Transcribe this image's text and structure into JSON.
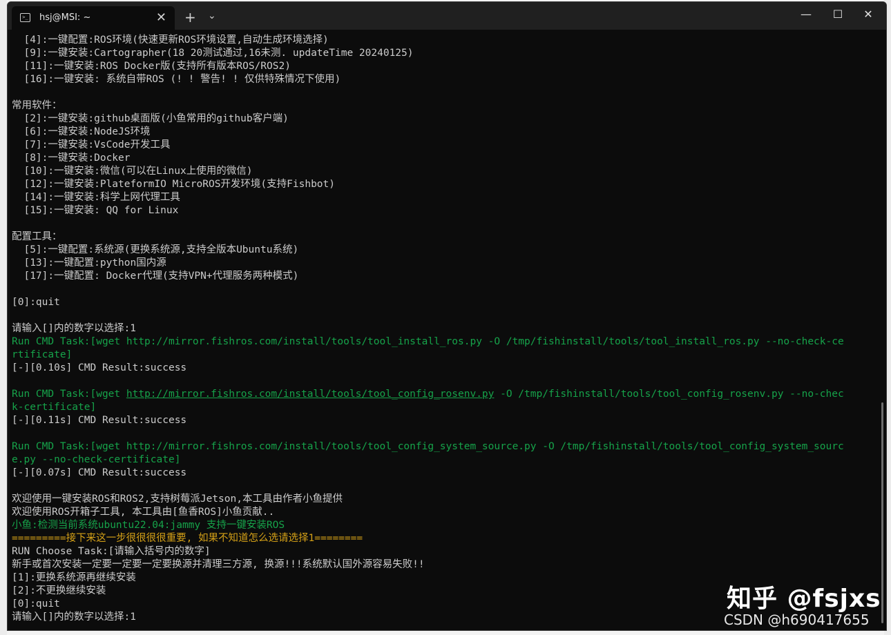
{
  "window": {
    "tab_title": "hsj@MSI: ~",
    "tab_icon": "terminal-icon",
    "tab_close": "✕",
    "new_tab": "+",
    "dropdown": "⌄",
    "minimize": "—",
    "maximize": "☐",
    "close": "✕"
  },
  "terminal": {
    "lines": [
      {
        "text": "  [4]:一键配置:ROS环境(快速更新ROS环境设置,自动生成环境选择)",
        "color": "default"
      },
      {
        "text": "  [9]:一键安装:Cartographer(18 20测试通过,16未测. updateTime 20240125)",
        "color": "default"
      },
      {
        "text": "  [11]:一键安装:ROS Docker版(支持所有版本ROS/ROS2)",
        "color": "default"
      },
      {
        "text": "  [16]:一键安装: 系统自带ROS (! ! 警告! ! 仅供特殊情况下使用)",
        "color": "default"
      },
      {
        "text": "",
        "color": "default"
      },
      {
        "text": "常用软件：",
        "color": "default"
      },
      {
        "text": "  [2]:一键安装:github桌面版(小鱼常用的github客户端)",
        "color": "default"
      },
      {
        "text": "  [6]:一键安装:NodeJS环境",
        "color": "default"
      },
      {
        "text": "  [7]:一键安装:VsCode开发工具",
        "color": "default"
      },
      {
        "text": "  [8]:一键安装:Docker",
        "color": "default"
      },
      {
        "text": "  [10]:一键安装:微信(可以在Linux上使用的微信)",
        "color": "default"
      },
      {
        "text": "  [12]:一键安装:PlateformIO MicroROS开发环境(支持Fishbot)",
        "color": "default"
      },
      {
        "text": "  [14]:一键安装:科学上网代理工具",
        "color": "default"
      },
      {
        "text": "  [15]:一键安装: QQ for Linux",
        "color": "default"
      },
      {
        "text": "",
        "color": "default"
      },
      {
        "text": "配置工具：",
        "color": "default"
      },
      {
        "text": "  [5]:一键配置:系统源(更换系统源,支持全版本Ubuntu系统)",
        "color": "default"
      },
      {
        "text": "  [13]:一键配置:python国内源",
        "color": "default"
      },
      {
        "text": "  [17]:一键配置: Docker代理(支持VPN+代理服务两种模式)",
        "color": "default"
      },
      {
        "text": "",
        "color": "default"
      },
      {
        "text": "[0]:quit",
        "color": "default"
      },
      {
        "text": "",
        "color": "default"
      },
      {
        "text": "请输入[]内的数字以选择:1",
        "color": "default"
      },
      {
        "text": "Run CMD Task:[wget http://mirror.fishros.com/install/tools/tool_install_ros.py -O /tmp/fishinstall/tools/tool_install_ros.py --no-check-ce",
        "color": "green"
      },
      {
        "text": "rtificate]",
        "color": "green"
      },
      {
        "text": "[-][0.10s] CMD Result:success",
        "color": "default"
      },
      {
        "text": "",
        "color": "default"
      },
      {
        "text": "Run CMD Task:[wget ",
        "color": "green",
        "link": "http://mirror.fishros.com/install/tools/tool_config_rosenv.py",
        "after": " -O /tmp/fishinstall/tools/tool_config_rosenv.py --no-chec"
      },
      {
        "text": "k-certificate]",
        "color": "green"
      },
      {
        "text": "[-][0.11s] CMD Result:success",
        "color": "default"
      },
      {
        "text": "",
        "color": "default"
      },
      {
        "text": "Run CMD Task:[wget http://mirror.fishros.com/install/tools/tool_config_system_source.py -O /tmp/fishinstall/tools/tool_config_system_sourc",
        "color": "green"
      },
      {
        "text": "e.py --no-check-certificate]",
        "color": "green"
      },
      {
        "text": "[-][0.07s] CMD Result:success",
        "color": "default"
      },
      {
        "text": "",
        "color": "default"
      },
      {
        "text": "欢迎使用一键安装ROS和ROS2,支持树莓派Jetson,本工具由作者小鱼提供",
        "color": "default"
      },
      {
        "text": "欢迎使用ROS开箱子工具, 本工具由[鱼香ROS]小鱼贡献..",
        "color": "default"
      },
      {
        "text": "小鱼:检测当前系统ubuntu22.04:jammy 支持一键安装ROS",
        "color": "green"
      },
      {
        "text": "=========接下来这一步很很很很重要, 如果不知道怎么选请选择1========",
        "color": "yellow"
      },
      {
        "text": "RUN Choose Task:[请输入括号内的数字]",
        "color": "default"
      },
      {
        "text": "新手或首次安装一定要一定要一定要换源并清理三方源, 换源!!!系统默认国外源容易失败!!",
        "color": "default"
      },
      {
        "text": "[1]:更换系统源再继续安装",
        "color": "default"
      },
      {
        "text": "[2]:不更换继续安装",
        "color": "default"
      },
      {
        "text": "[0]:quit",
        "color": "default"
      },
      {
        "text": "请输入[]内的数字以选择:1",
        "color": "default"
      }
    ]
  },
  "watermark": {
    "zhihu": "知乎 @fsjxs",
    "csdn": "CSDN @h690417655"
  },
  "colors": {
    "terminal_bg": "#0c0c0c",
    "text": "#cccccc",
    "green": "#16a34a",
    "yellow": "#d4a017",
    "titlebar": "#202020"
  }
}
